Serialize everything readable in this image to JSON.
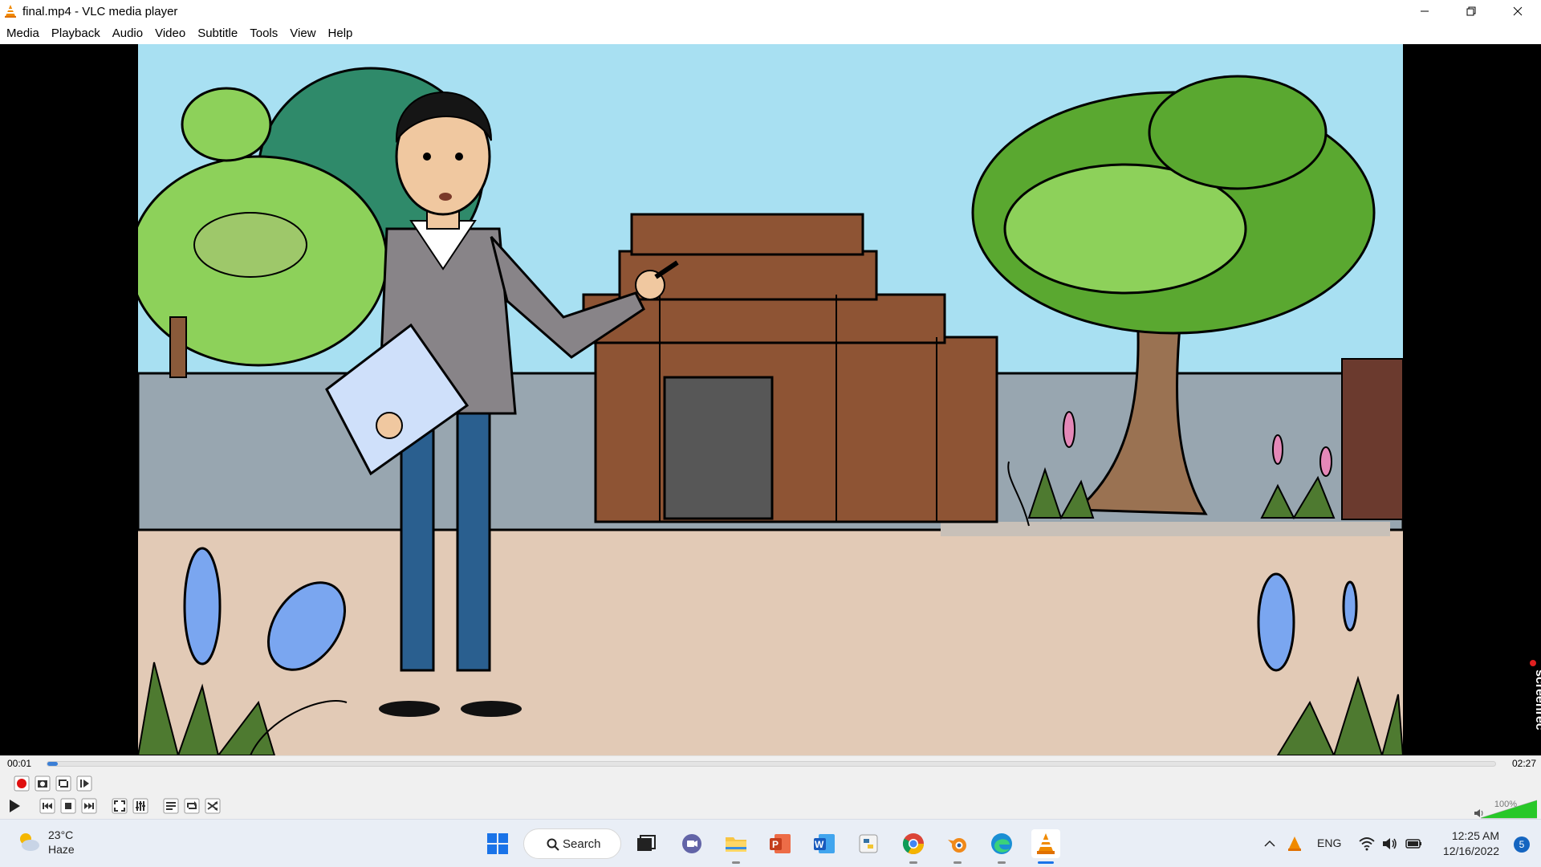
{
  "window": {
    "title": "final.mp4 - VLC media player",
    "minimize_icon": "minimize-icon",
    "maximize_icon": "restore-icon",
    "close_icon": "close-icon"
  },
  "menu": [
    "Media",
    "Playback",
    "Audio",
    "Video",
    "Subtitle",
    "Tools",
    "View",
    "Help"
  ],
  "player": {
    "elapsed": "00:01",
    "duration": "02:27",
    "progress_fraction": 0.007,
    "volume_label": "100%",
    "volume_fraction": 1.0,
    "overlay_watermark": "screenrec"
  },
  "taskbar": {
    "weather_temp": "23°C",
    "weather_desc": "Haze",
    "search_label": "Search",
    "language": "ENG",
    "time": "12:25 AM",
    "date": "12/16/2022",
    "notifications": "5"
  }
}
